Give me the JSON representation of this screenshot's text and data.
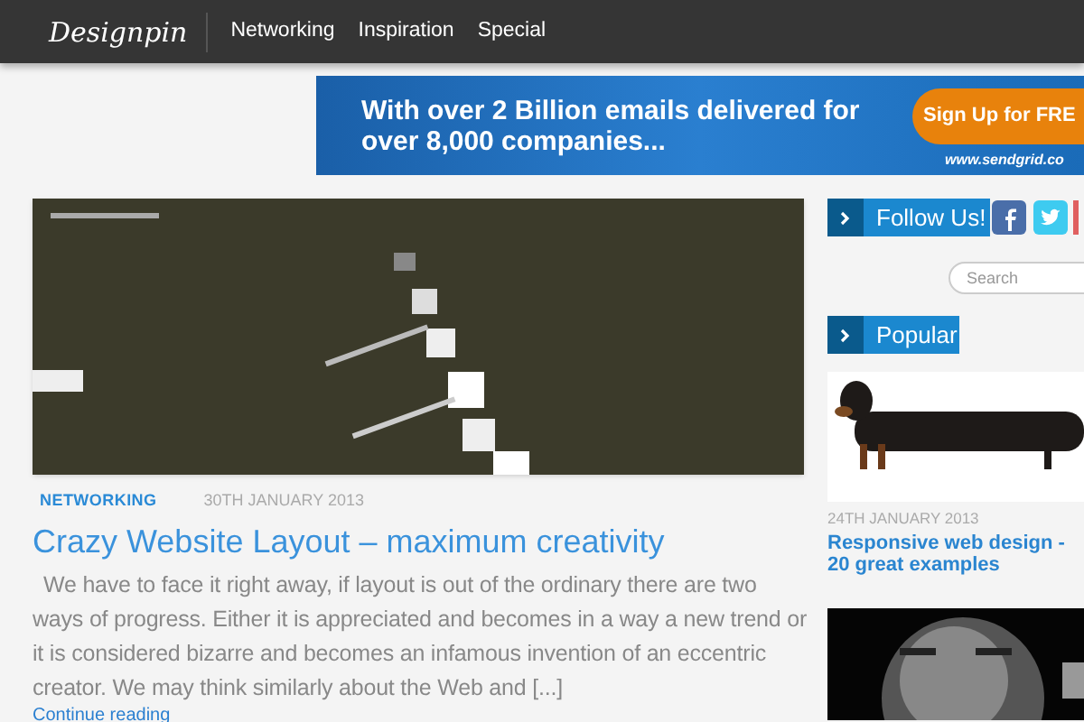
{
  "header": {
    "logo": "Designpin",
    "nav": [
      {
        "label": "Networking"
      },
      {
        "label": "Inspiration"
      },
      {
        "label": "Special"
      }
    ]
  },
  "ad": {
    "headline": "With over 2 Billion emails delivered for over 8,000 companies...",
    "button": "Sign Up for FRE",
    "url": "www.sendgrid.co"
  },
  "post": {
    "image": {
      "kind": "picture"
    },
    "category": "NETWORKING",
    "date": "30TH JANUARY 2013",
    "title": "Crazy Website Layout – maximum creativity",
    "excerpt": "We have to face it right away, if layout is out of the ordinary there are two ways of progress. Either it is appreciated and becomes in a way a new trend or it is considered bizarre and becomes an infamous invention of an eccentric creator. We may think similarly about the Web and [...]",
    "more": "Continue reading"
  },
  "sidebar": {
    "follow": {
      "label": "Follow Us!"
    },
    "search": {
      "placeholder": "Search"
    },
    "popular": {
      "label": "Popular"
    },
    "items": [
      {
        "date": "24TH JANUARY 2013",
        "title": "Responsive web design - 20 great examples"
      },
      {
        "image": {
          "kind": "picture"
        }
      }
    ]
  }
}
